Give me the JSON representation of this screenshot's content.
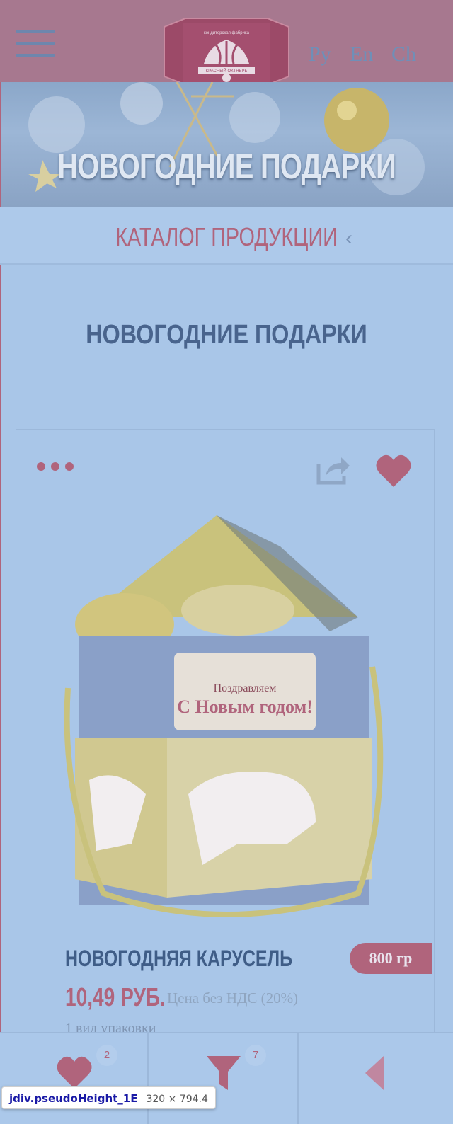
{
  "header": {
    "languages": [
      "Ру",
      "En",
      "Ch"
    ],
    "logo_alt": "Красный Октябрь"
  },
  "banner": {
    "title": "НОВОГОДНИЕ ПОДАРКИ"
  },
  "catalog": {
    "label": "КАТАЛОГ ПРОДУКЦИИ"
  },
  "section": {
    "title": "НОВОГОДНИЕ ПОДАРКИ"
  },
  "product": {
    "name": "НОВОГОДНЯЯ КАРУСЕЛЬ",
    "weight": "800 гр",
    "price": "10,49 РУБ.",
    "price_note": "Цена без НДС (20%)",
    "package": "1 вид упаковки",
    "image_text": [
      "Поздравляем",
      "С Новым годом!"
    ]
  },
  "bottombar": {
    "favorites_count": "2",
    "filter_count": "7"
  },
  "tooltip": {
    "name": "jdiv.pseudoHeight_1E",
    "size": "320 × 794.4"
  },
  "colors": {
    "accent": "#b0647c",
    "header": "#a7788f",
    "background": "#a9c6e8",
    "title": "#49648d"
  }
}
